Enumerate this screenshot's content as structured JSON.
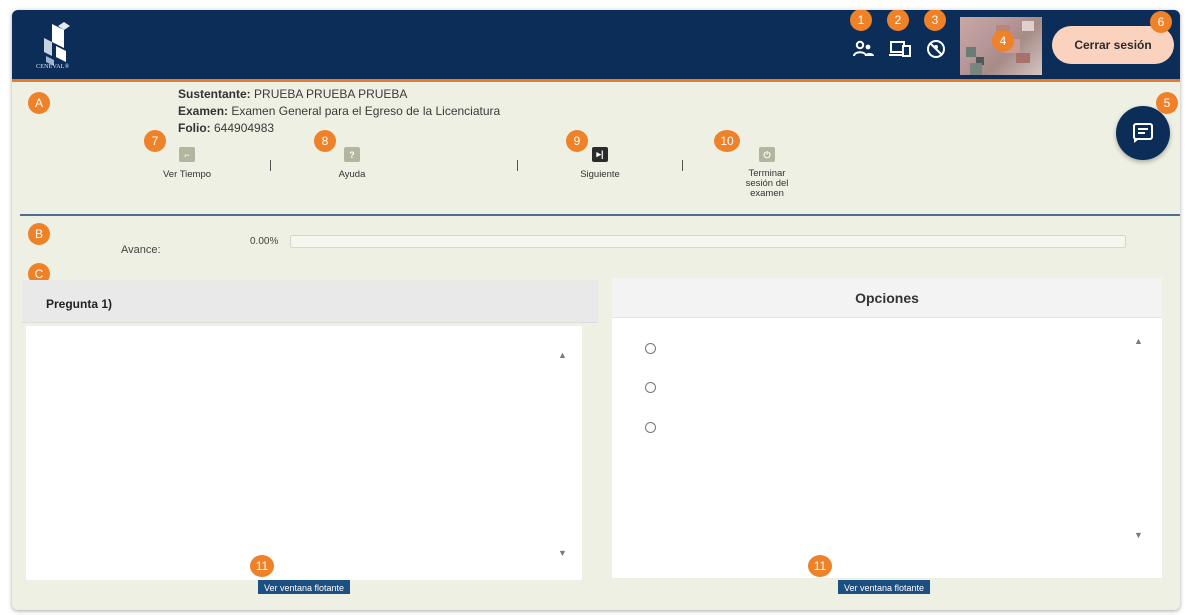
{
  "header": {
    "logo_text": "CENEVAL®",
    "logout_label": "Cerrar sesión",
    "icons": [
      "users-icon",
      "devices-icon",
      "blocked-icon"
    ]
  },
  "badges": {
    "b1": "1",
    "b2": "2",
    "b3": "3",
    "b4": "4",
    "b5": "5",
    "b6": "6",
    "b7": "7",
    "b8": "8",
    "b9": "9",
    "b10": "10",
    "b11": "11",
    "A": "A",
    "B": "B",
    "C": "C"
  },
  "info": {
    "sustentante_label": "Sustentante:",
    "sustentante_value": "PRUEBA PRUEBA PRUEBA",
    "examen_label": "Examen:",
    "examen_value": "Examen General para el Egreso de la Licenciatura",
    "folio_label": "Folio:",
    "folio_value": "644904983"
  },
  "toolbar": {
    "ver_tiempo": "Ver Tiempo",
    "ayuda": "Ayuda",
    "siguiente": "Siguiente",
    "terminar_line1": "Terminar",
    "terminar_line2": "sesión del",
    "terminar_line3": "examen"
  },
  "progress": {
    "label": "Avance:",
    "percent_text": "0.00%",
    "value": 0.0
  },
  "question": {
    "title": "Pregunta 1)",
    "float_button": "Ver ventana flotante"
  },
  "options": {
    "title": "Opciones",
    "float_button": "Ver ventana flotante",
    "count": 3
  },
  "colors": {
    "header_bg": "#0d2d59",
    "accent_orange": "#ef8129",
    "page_bg": "#eef0e3",
    "logout_bg": "#fbd2bd",
    "float_btn_bg": "#1c4f82"
  }
}
